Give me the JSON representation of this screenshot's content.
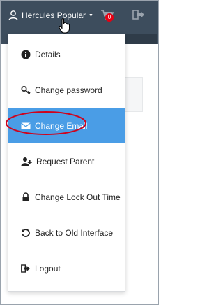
{
  "header": {
    "user_name": "Hercules Popular",
    "user_icon": "user-outline-icon",
    "caret_icon": "caret-down-icon",
    "cart_icon": "cart-icon",
    "cart_count": "0",
    "logout_icon": "sign-out-icon"
  },
  "dropdown": {
    "items": [
      {
        "label": "Details",
        "icon": "info-circle-icon"
      },
      {
        "label": "Change password",
        "icon": "key-icon"
      },
      {
        "label": "Change Email",
        "icon": "envelope-icon",
        "active": true
      },
      {
        "label": "Request Parent",
        "icon": "user-plus-icon"
      },
      {
        "label": "Change Lock Out Time",
        "icon": "lock-icon"
      },
      {
        "label": "Back to Old Interface",
        "icon": "undo-icon"
      },
      {
        "label": "Logout",
        "icon": "sign-out-icon"
      }
    ]
  },
  "colors": {
    "navbar": "#3d4d5d",
    "active_item": "#4a9de6",
    "annotation": "#d0021b",
    "badge": "#e60012"
  }
}
